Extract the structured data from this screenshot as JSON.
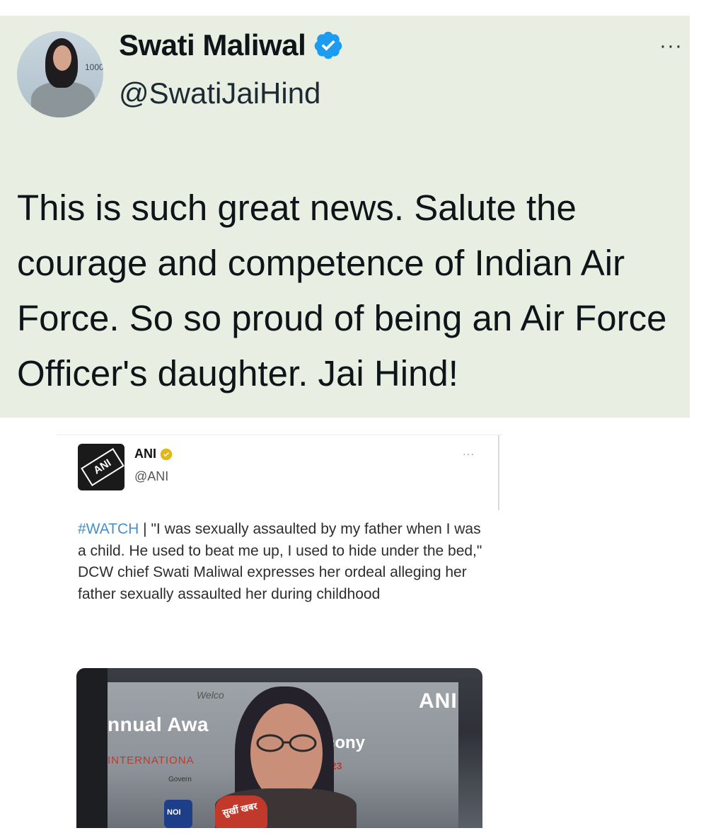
{
  "tweet": {
    "author_name": "Swati Maliwal",
    "author_handle": "@SwatiJaiHind",
    "more_label": "···",
    "text": "This is such great news. Salute the courage and competence of Indian Air Force. So so proud of being an Air Force Officer's daughter. Jai Hind!",
    "avatar_banner_text": "1000"
  },
  "quoted_tweet": {
    "author_name": "ANI",
    "author_handle": "@ANI",
    "more_label": "···",
    "logo_text": "ANI",
    "hashtag": "#WATCH",
    "text": " | \"I was sexually assaulted by my father when I was a child. He used to beat me up, I used to hide under the bed,\" DCW chief Swati Maliwal expresses her ordeal alleging her father sexually assaulted her during childhood"
  },
  "video": {
    "watermark": "ANI",
    "banner_left": "nnual Awa",
    "banner_right": "cony",
    "script_text": "Welco",
    "intl_text": "INTERNATIONA",
    "year_text": "023",
    "gov_text": "Govern",
    "mic1_text": "सुर्खी खबर",
    "mic2_text": "NOI"
  },
  "colors": {
    "tweet_bg": "#e8efe2",
    "verified_blue": "#1d9bf0",
    "verified_gold": "#e2b719",
    "hashtag": "#4a8ec8"
  },
  "icons": [
    "verified-badge-icon",
    "more-options-icon",
    "gold-verified-badge-icon"
  ]
}
